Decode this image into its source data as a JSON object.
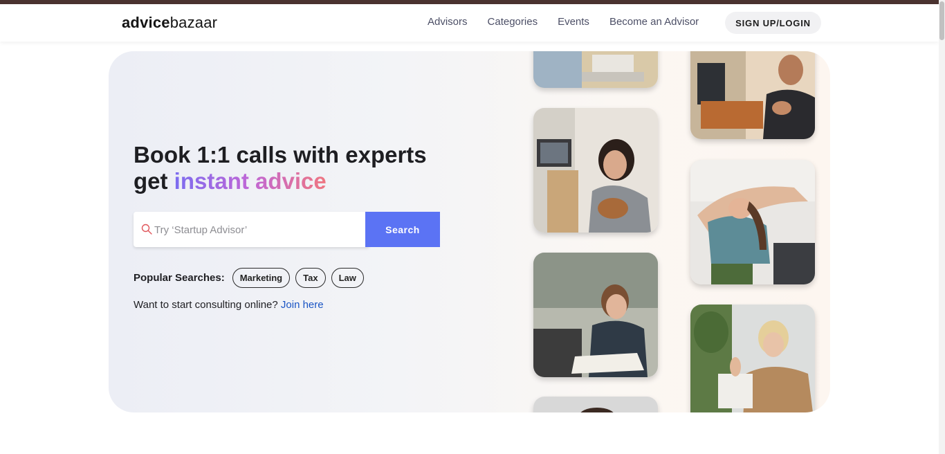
{
  "brand": {
    "logo_bold": "advice",
    "logo_light": "bazaar"
  },
  "nav": {
    "links": [
      "Advisors",
      "Categories",
      "Events",
      "Become an Advisor"
    ],
    "signup_label": "SIGN UP/LOGIN"
  },
  "hero": {
    "headline_line1": "Book 1:1 calls with experts",
    "headline_line2_plain": "get ",
    "headline_line2_accent": "instant advice",
    "search": {
      "placeholder": "Try ‘Startup Advisor’",
      "value": "",
      "button_label": "Search"
    },
    "popular_label": "Popular Searches:",
    "popular_tags": [
      "Marketing",
      "Tax",
      "Law"
    ],
    "consult_text": "Want to start consulting online?",
    "consult_link": "Join here"
  },
  "colors": {
    "accent": "#5b73f4",
    "link": "#1a55c4",
    "gradient": [
      "#7c6cf0",
      "#c067d6",
      "#ef7680"
    ],
    "topbar": "#4a3330"
  },
  "icons": {
    "search": "search-icon"
  }
}
